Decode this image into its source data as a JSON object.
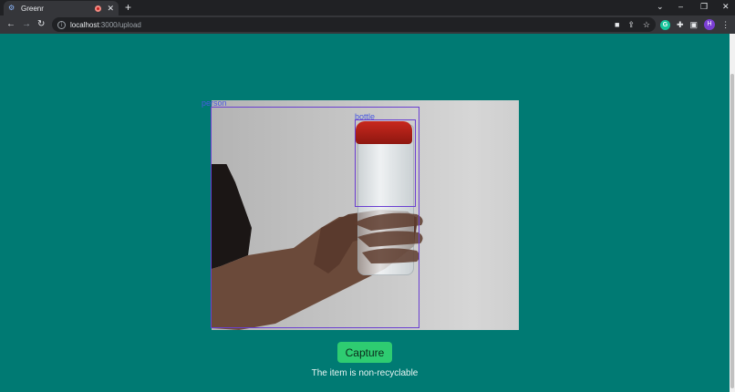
{
  "browser": {
    "tab": {
      "title": "Greenr"
    },
    "new_tab_symbol": "+",
    "url": {
      "host": "localhost",
      "path": ":3000/upload"
    },
    "profile_initial": "H",
    "grammarly_initial": "G"
  },
  "page": {
    "background": "#007a73",
    "detections": [
      {
        "label": "person"
      },
      {
        "label": "bottle"
      }
    ],
    "capture_button": {
      "label": "Capture",
      "color": "#2ecc71"
    },
    "result_text": "The item is non-recyclable"
  },
  "icons": {
    "tab_favicon": "gear-icon",
    "back": "arrow-left-icon",
    "forward": "arrow-right-icon",
    "reload": "reload-icon",
    "site_info": "info-icon",
    "camera_indicator": "video-camera-icon",
    "share": "share-icon",
    "bookmark": "star-icon",
    "extensions": "puzzle-icon",
    "side_panel": "side-panel-icon",
    "menu": "kebab-menu-icon"
  }
}
